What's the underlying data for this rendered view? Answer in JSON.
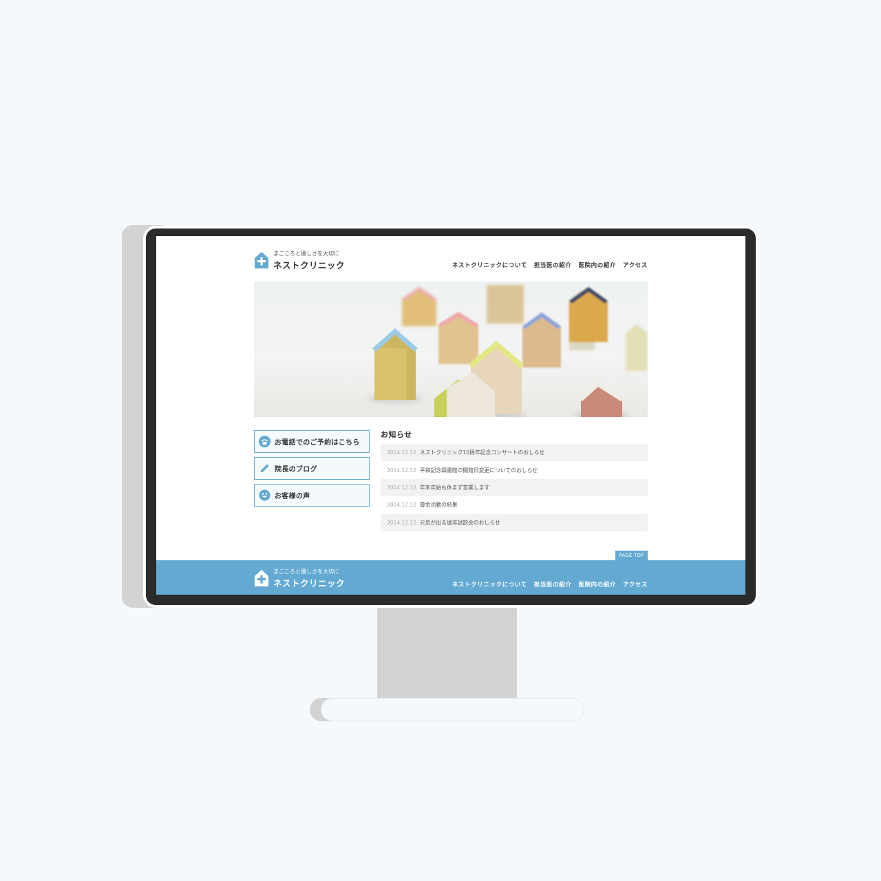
{
  "site": {
    "tagline": "まごころと優しさを大切に",
    "name": "ネストクリニック"
  },
  "nav": [
    {
      "label": "ネストクリニックについて"
    },
    {
      "label": "担当医の紹介"
    },
    {
      "label": "医院内の紹介"
    },
    {
      "label": "アクセス"
    }
  ],
  "sidebar": [
    {
      "label": "お電話でのご予約はこちら",
      "icon": "phone-icon"
    },
    {
      "label": "院長のブログ",
      "icon": "pencil-icon"
    },
    {
      "label": "お客様の声",
      "icon": "smile-icon"
    }
  ],
  "news": {
    "title": "お知らせ",
    "items": [
      {
        "date": "2014.12.12",
        "text": "ネストクリニック10周年記念コンサートのおしらせ"
      },
      {
        "date": "2014.12.12",
        "text": "平和記念図書館の開館日変更についてのおしらせ"
      },
      {
        "date": "2014.12.12",
        "text": "年末年始も休まず営業します"
      },
      {
        "date": "2014.12.12",
        "text": "募金活動の結果"
      },
      {
        "date": "2014.12.12",
        "text": "元気が出る珈琲試飲会のおしらせ"
      }
    ]
  },
  "page_top": "PAGE TOP",
  "colors": {
    "accent": "#63a9d2",
    "background": "#f5f9fc",
    "bezel": "#2b2b2b"
  }
}
